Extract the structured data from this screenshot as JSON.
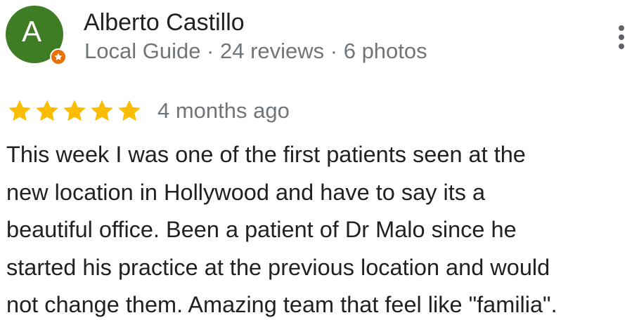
{
  "reviewer": {
    "avatar_letter": "A",
    "name": "Alberto Castillo",
    "meta": "Local Guide · 24 reviews · 6 photos",
    "avatar_color": "#3f7d25",
    "badge_color": "#e8710a",
    "badge_icon": "local-guide-star-icon"
  },
  "review": {
    "rating": 5,
    "rating_max": 5,
    "star_color": "#fbbc04",
    "date": "4 months ago",
    "lines": [
      "This week I was one of the first patients seen at the",
      "new location in Hollywood and have to say its a",
      "beautiful office. Been a patient of Dr Malo since he",
      "started his practice at the previous location and would",
      "not change them. Amazing team that feel like \"familia\"."
    ]
  },
  "actions": {
    "more_icon": "more-vertical-icon"
  }
}
